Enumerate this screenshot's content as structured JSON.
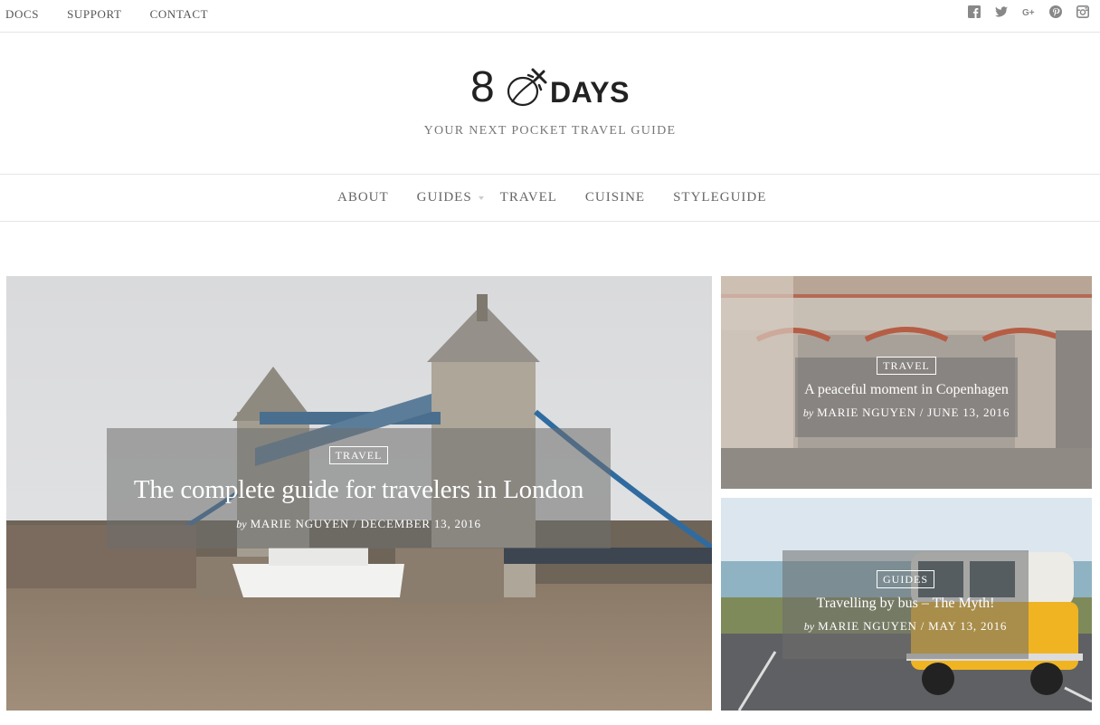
{
  "topbar": {
    "links": [
      "DOCS",
      "SUPPORT",
      "CONTACT"
    ],
    "social_icons": [
      "facebook-icon",
      "twitter-icon",
      "google-plus-icon",
      "pinterest-icon",
      "instagram-icon"
    ]
  },
  "header": {
    "logo_number": "8",
    "logo_word": "DAYS",
    "tagline": "YOUR NEXT POCKET TRAVEL GUIDE"
  },
  "nav": {
    "items": [
      "ABOUT",
      "GUIDES",
      "TRAVEL",
      "CUISINE",
      "STYLEGUIDE"
    ]
  },
  "posts": [
    {
      "category": "TRAVEL",
      "title": "The complete guide for travelers in London",
      "by": "by",
      "author": "MARIE NGUYEN",
      "date": "DECEMBER 13, 2016"
    },
    {
      "category": "TRAVEL",
      "title": "A peaceful moment in Copenhagen",
      "by": "by",
      "author": "MARIE NGUYEN",
      "date": "JUNE 13, 2016"
    },
    {
      "category": "GUIDES",
      "title": "Travelling by bus – The Myth!",
      "by": "by",
      "author": "MARIE NGUYEN",
      "date": "MAY 13, 2016"
    }
  ],
  "colors": {
    "text_dark": "#222222",
    "text_muted": "#777777",
    "overlay": "#6e6e6e",
    "divider": "#e6e6e6"
  }
}
